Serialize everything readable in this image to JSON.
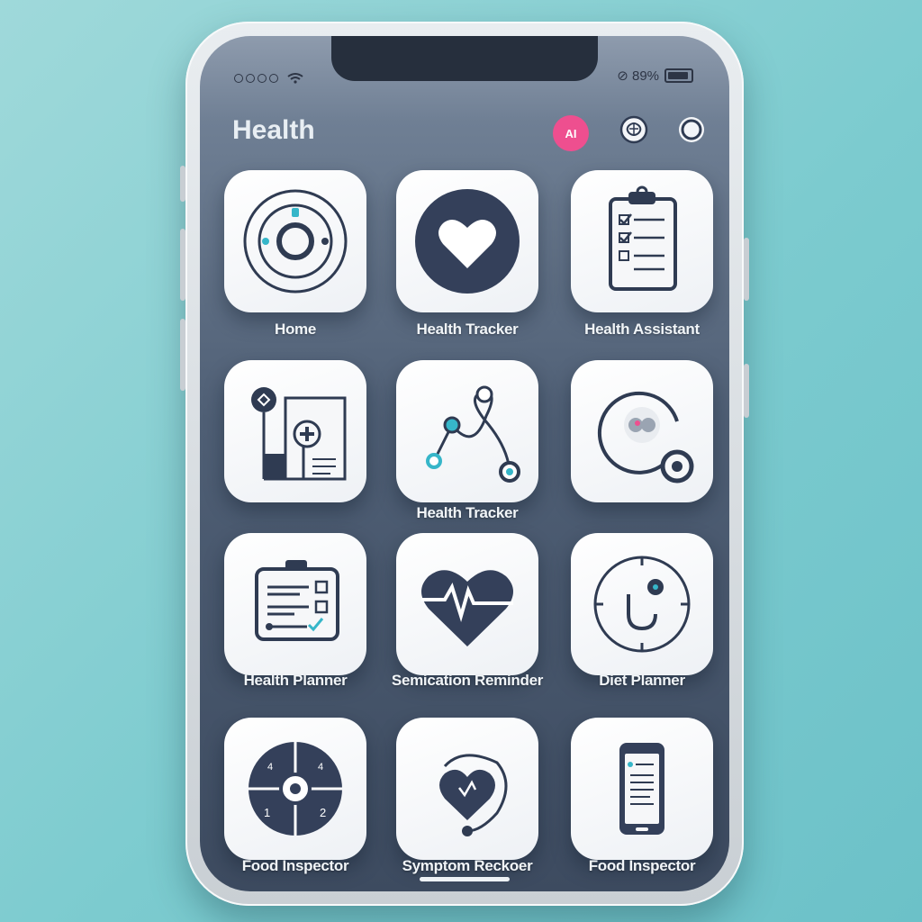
{
  "status_bar": {
    "right_text": "⊘ 89%"
  },
  "header": {
    "title": "Health",
    "ai_badge": "AI"
  },
  "tiles": [
    {
      "label": "Home",
      "icon": "target-dial-icon"
    },
    {
      "label": "Health Tracker",
      "icon": "heart-icon"
    },
    {
      "label": "Health Assistant",
      "icon": "clipboard-checklist-icon"
    },
    {
      "label": "",
      "icon": "medical-document-icon"
    },
    {
      "label": "Health Tracker",
      "icon": "connected-nodes-icon"
    },
    {
      "label": "",
      "icon": "stethoscope-circle-icon"
    },
    {
      "label": "Health Planner",
      "icon": "checklist-board-icon"
    },
    {
      "label": "Semication Reminder",
      "icon": "heart-pulse-icon"
    },
    {
      "label": "Diet Planner",
      "icon": "stethoscope-dial-icon"
    },
    {
      "label": "Food Inspector",
      "icon": "quadrant-dial-icon"
    },
    {
      "label": "Symptom Reckoer",
      "icon": "heart-stethoscope-icon"
    },
    {
      "label": "Food Inspector",
      "icon": "phone-document-icon"
    }
  ],
  "colors": {
    "accent": "#ee4f8f",
    "icon_dark": "#2f3b52",
    "icon_teal": "#36b6c9"
  }
}
